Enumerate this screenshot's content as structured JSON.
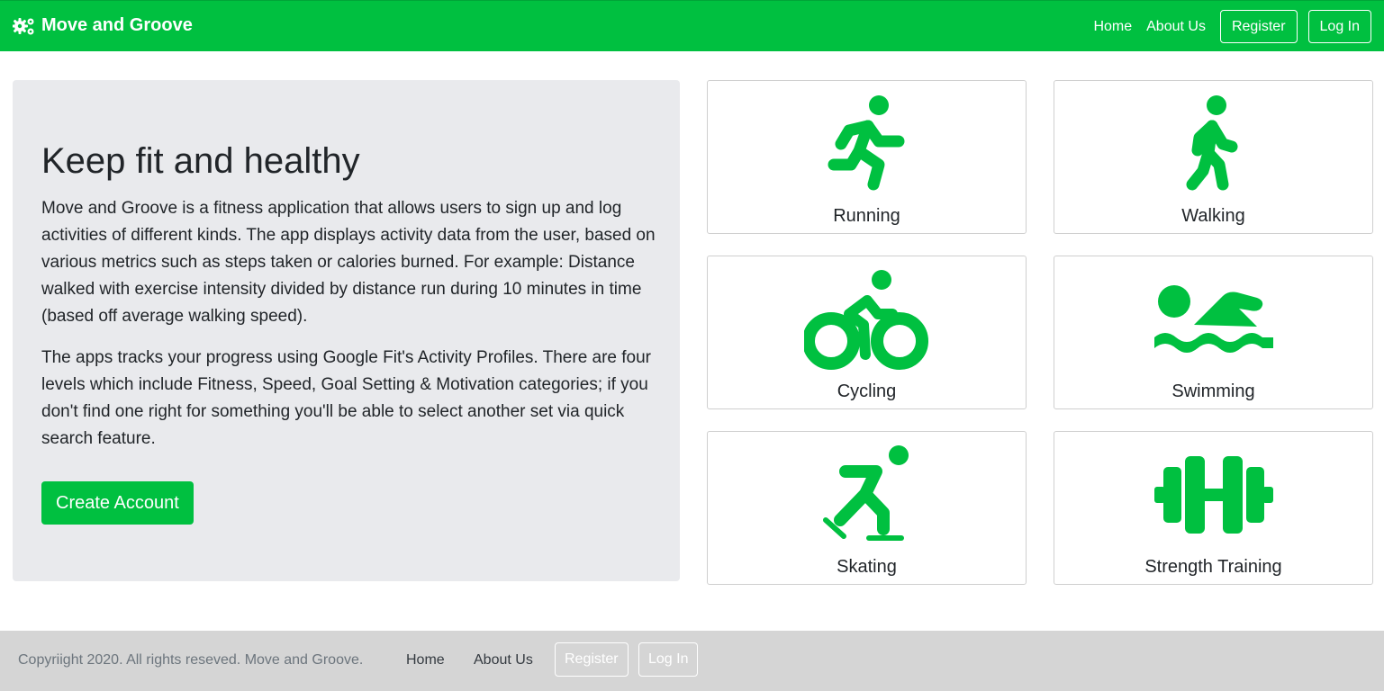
{
  "brand": {
    "name": "Move and Groove",
    "icon": "gears-icon"
  },
  "nav": {
    "home": "Home",
    "about": "About Us",
    "register": "Register",
    "login": "Log In"
  },
  "hero": {
    "title": "Keep fit and healthy",
    "paragraph1": "Move and Groove is a fitness application that allows users to sign up and log activities of different kinds. The app displays activity data from the user, based on various metrics such as steps taken or calories burned. For example: Distance walked with exercise intensity divided by distance run during 10 minutes in time (based off average walking speed).",
    "paragraph2": "The apps tracks your progress using Google Fit's Activity Profiles. There are four levels which include Fitness, Speed, Goal Setting & Motivation categories; if you don't find one right for something you'll be able to select another set via quick search feature.",
    "cta": "Create Account"
  },
  "activities": [
    {
      "label": "Running",
      "icon": "running-icon"
    },
    {
      "label": "Walking",
      "icon": "walking-icon"
    },
    {
      "label": "Cycling",
      "icon": "biking-icon"
    },
    {
      "label": "Swimming",
      "icon": "swimmer-icon"
    },
    {
      "label": "Skating",
      "icon": "skating-icon"
    },
    {
      "label": "Strength Training",
      "icon": "dumbbell-icon"
    }
  ],
  "footer": {
    "copyright": "Copyriight 2020. All rights reseved. Move and Groove.",
    "home": "Home",
    "about": "About Us",
    "register": "Register",
    "login": "Log In"
  },
  "colors": {
    "accent": "#00c040",
    "panel": "#e9eaed",
    "footer": "#d5d5d5"
  }
}
